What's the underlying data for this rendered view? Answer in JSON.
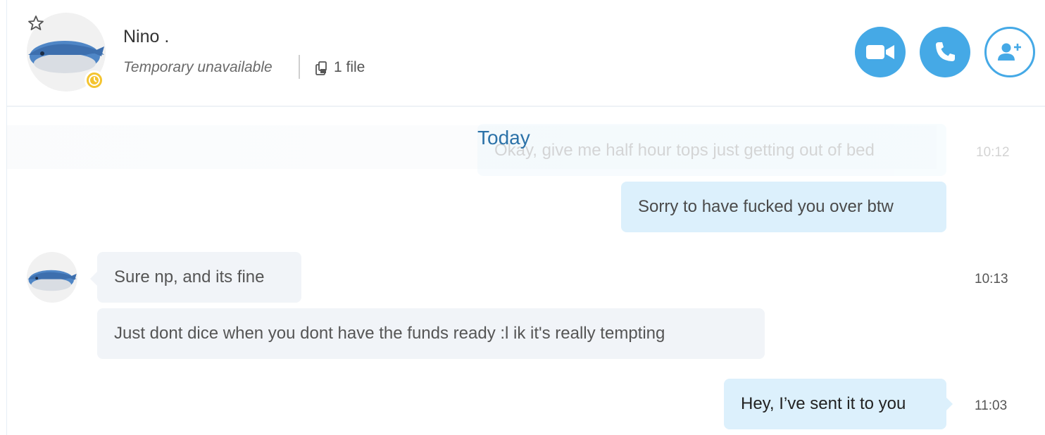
{
  "contact": {
    "name": "Nino .",
    "status": "Temporary unavailable",
    "files": "1 file"
  },
  "header_buttons": {
    "video": "video-call-button",
    "call": "audio-call-button",
    "add": "add-participant-button"
  },
  "colors": {
    "accent": "#45a9e6",
    "outgoing_bubble": "#dcf0fc",
    "incoming_bubble": "#f1f4f8",
    "status_away": "#f4c430",
    "date_label": "#2c72a8"
  },
  "date_divider": "Today",
  "messages": [
    {
      "direction": "out",
      "text": "Okay, give me half hour tops just getting out of bed",
      "time": "10:12"
    },
    {
      "direction": "out",
      "text": "Sorry to have fucked you over btw",
      "time": ""
    },
    {
      "direction": "in",
      "text": "Sure np, and its fine",
      "time": "10:13"
    },
    {
      "direction": "in",
      "text": "Just dont dice when you dont have the funds ready :l ik it's really tempting",
      "time": ""
    },
    {
      "direction": "out",
      "text": "Hey, I’ve sent it to you",
      "time": "11:03"
    }
  ]
}
